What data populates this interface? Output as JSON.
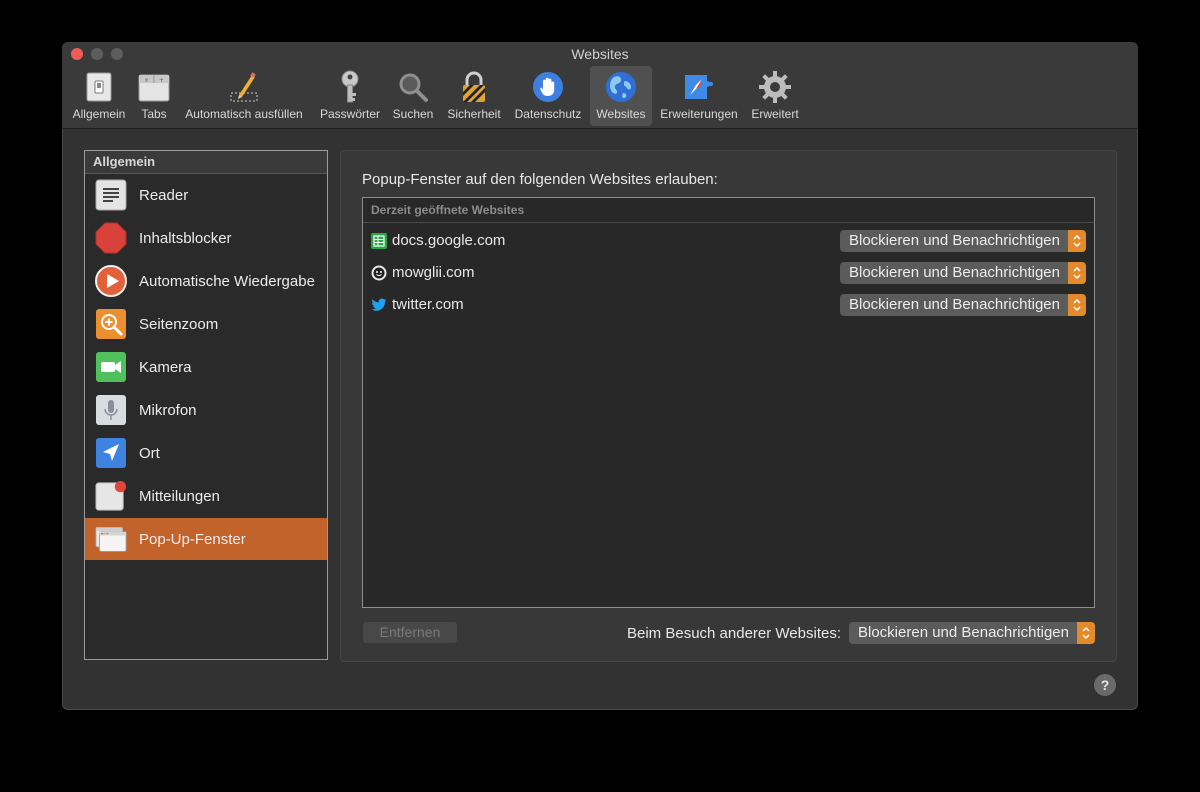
{
  "window": {
    "title": "Websites"
  },
  "toolbar": {
    "items": [
      {
        "label": "Allgemein",
        "icon": "general-switch-icon"
      },
      {
        "label": "Tabs",
        "icon": "tabs-icon"
      },
      {
        "label": "Automatisch ausfüllen",
        "icon": "pencil-icon"
      },
      {
        "label": "Passwörter",
        "icon": "key-icon"
      },
      {
        "label": "Suchen",
        "icon": "magnifier-icon"
      },
      {
        "label": "Sicherheit",
        "icon": "lock-icon"
      },
      {
        "label": "Datenschutz",
        "icon": "hand-icon"
      },
      {
        "label": "Websites",
        "icon": "globe-icon",
        "active": true
      },
      {
        "label": "Erweiterungen",
        "icon": "puzzle-compass-icon"
      },
      {
        "label": "Erweitert",
        "icon": "gear-icon"
      }
    ]
  },
  "sidebar": {
    "header": "Allgemein",
    "items": [
      {
        "label": "Reader",
        "icon": "reader-icon"
      },
      {
        "label": "Inhaltsblocker",
        "icon": "stop-sign-icon"
      },
      {
        "label": "Automatische Wiedergabe",
        "icon": "play-icon"
      },
      {
        "label": "Seitenzoom",
        "icon": "zoom-icon"
      },
      {
        "label": "Kamera",
        "icon": "camera-icon"
      },
      {
        "label": "Mikrofon",
        "icon": "microphone-icon"
      },
      {
        "label": "Ort",
        "icon": "location-icon"
      },
      {
        "label": "Mitteilungen",
        "icon": "notifications-icon"
      },
      {
        "label": "Pop-Up-Fenster",
        "icon": "popup-windows-icon",
        "selected": true
      }
    ]
  },
  "main": {
    "heading": "Popup-Fenster auf den folgenden Websites erlauben:",
    "table_header": "Derzeit geöffnete Websites",
    "rows": [
      {
        "site": "docs.google.com",
        "setting": "Blockieren und Benachrichtigen",
        "icon": "google-sheets-icon"
      },
      {
        "site": "mowglii.com",
        "setting": "Blockieren und Benachrichtigen",
        "icon": "mowglii-icon"
      },
      {
        "site": "twitter.com",
        "setting": "Blockieren und Benachrichtigen",
        "icon": "twitter-bird-icon"
      }
    ],
    "remove_button": "Entfernen",
    "other_label": "Beim Besuch anderer Websites:",
    "other_setting": "Blockieren und Benachrichtigen"
  },
  "help": {
    "label": "?"
  },
  "colors": {
    "accent": "#c2632b",
    "stepper": "#e38a2d",
    "close": "#ee5e57"
  }
}
